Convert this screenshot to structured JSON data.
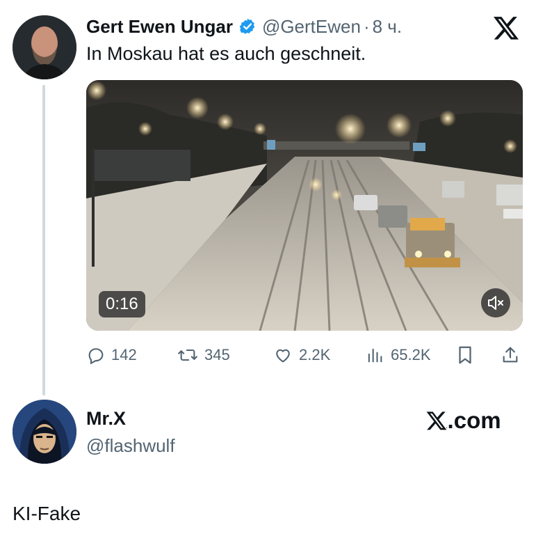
{
  "tweet": {
    "author_name": "Gert Ewen Ungar",
    "handle": "@GertEwen",
    "separator": "·",
    "time": "8 ч.",
    "text": "In Moskau hat es auch geschneit.",
    "video": {
      "duration": "0:16"
    },
    "actions": {
      "replies": "142",
      "reposts": "345",
      "likes": "2.2K",
      "views": "65.2K"
    }
  },
  "reply": {
    "author_name": "Mr.X",
    "handle": "@flashwulf",
    "text": "KI-Fake",
    "brand": "X.com"
  },
  "colors": {
    "text": "#0f1419",
    "secondary": "#536471",
    "verified": "#1d9bf0",
    "thread_line": "#cfd9de"
  }
}
